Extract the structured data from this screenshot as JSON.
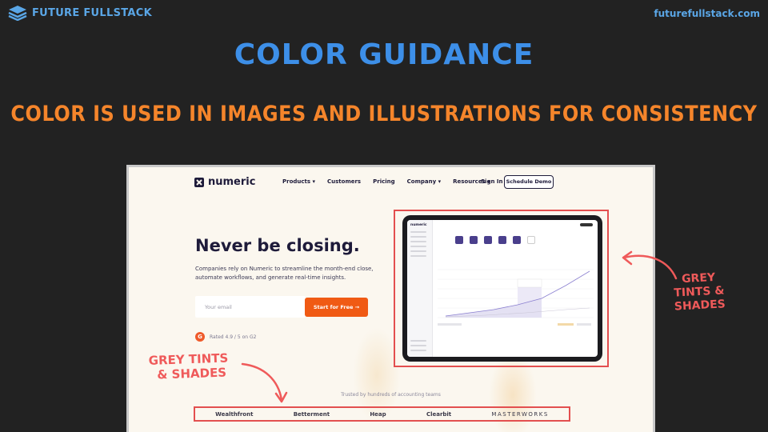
{
  "header": {
    "brand_name": "FUTURE FULLSTACK",
    "site_url": "futurefullstack.com"
  },
  "slide": {
    "title": "COLOR GUIDANCE",
    "subtitle": "COLOR IS USED IN IMAGES AND ILLUSTRATIONS FOR CONSISTENCY"
  },
  "website": {
    "logo_text": "numeric",
    "nav_items": [
      "Products ▾",
      "Customers",
      "Pricing",
      "Company ▾",
      "Resources ▾"
    ],
    "sign_in": "Sign In",
    "demo_button": "Schedule Demo",
    "hero_title": "Never be closing.",
    "hero_description": "Companies rely on Numeric to streamline the month-end close, automate workflows, and generate real-time insights.",
    "email_placeholder": "Your email",
    "cta_button": "Start for Free →",
    "rating_text": "Rated 4.9 / 5 on G2",
    "g2_letter": "G",
    "trusted_text": "Trusted by hundreds of accounting teams",
    "customer_logos": [
      "Wealthfront",
      "Betterment",
      "Heap",
      "Clearbit",
      "MASTERWORKS"
    ]
  },
  "annotations": {
    "right": [
      "GREY",
      "TINTS &",
      "SHADES"
    ],
    "left": [
      "GREY TINTS",
      "& SHADES"
    ]
  },
  "colors": {
    "background": "#222222",
    "title": "#3d8fe8",
    "subtitle": "#f5852b",
    "annotation": "#ef5a5a",
    "cta": "#f05a14"
  }
}
